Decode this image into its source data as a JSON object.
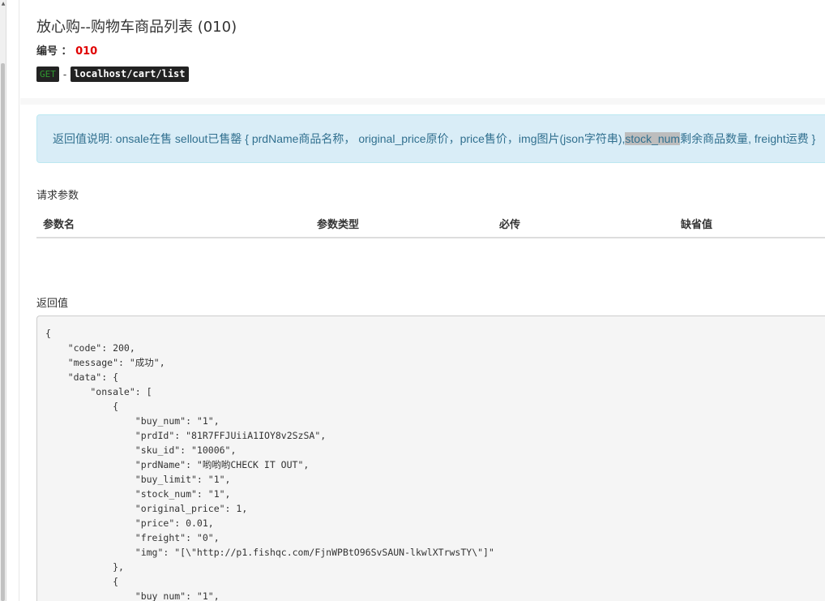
{
  "header": {
    "title": "放心购--购物车商品列表 (010)",
    "number_label": "编号 ：",
    "number_value": "010",
    "method": "GET",
    "separator": "-",
    "url": "localhost/cart/list"
  },
  "info": {
    "text_before": "返回值说明: onsale在售 sellout已售罄 { prdName商品名称， original_price原价，price售价，img图片(json字符串), ",
    "highlight": "stock_num",
    "text_after": "剩余商品数量, freight运费 }"
  },
  "params": {
    "label": "请求参数",
    "columns": [
      "参数名",
      "参数类型",
      "必传",
      "缺省值"
    ]
  },
  "response": {
    "label": "返回值",
    "code": "{\n    \"code\": 200,\n    \"message\": \"成功\",\n    \"data\": {\n        \"onsale\": [\n            {\n                \"buy_num\": \"1\",\n                \"prdId\": \"81R7FFJUiiA1IOY8v2SzSA\",\n                \"sku_id\": \"10006\",\n                \"prdName\": \"哟哟哟CHECK IT OUT\",\n                \"buy_limit\": \"1\",\n                \"stock_num\": \"1\",\n                \"original_price\": 1,\n                \"price\": 0.01,\n                \"freight\": \"0\",\n                \"img\": \"[\\\"http://p1.fishqc.com/FjnWPBtO96SvSAUN-lkwlXTrwsTY\\\"]\"\n            },\n            {\n                \"buy_num\": \"1\","
  }
}
